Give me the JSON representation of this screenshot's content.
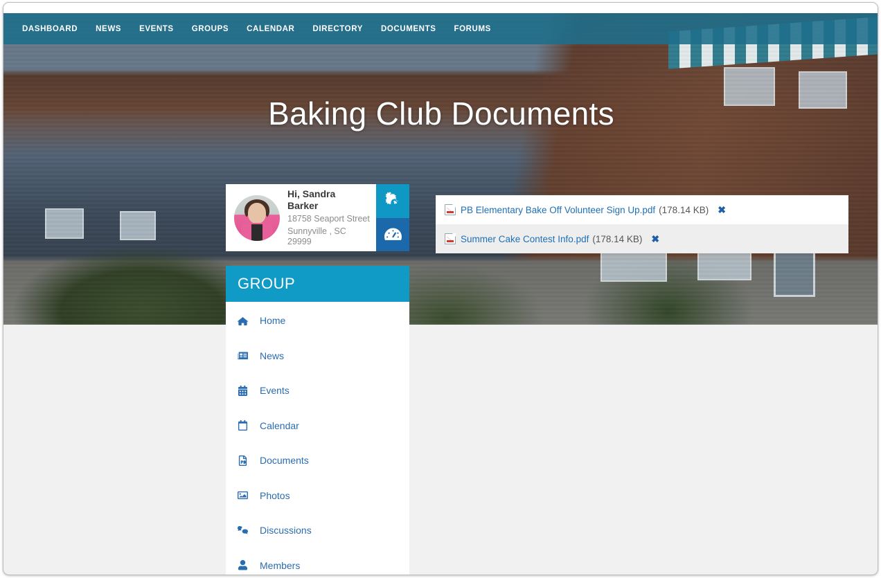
{
  "topnav": {
    "items": [
      {
        "label": "DASHBOARD",
        "name": "nav-dashboard"
      },
      {
        "label": "NEWS",
        "name": "nav-news"
      },
      {
        "label": "EVENTS",
        "name": "nav-events"
      },
      {
        "label": "GROUPS",
        "name": "nav-groups"
      },
      {
        "label": "CALENDAR",
        "name": "nav-calendar"
      },
      {
        "label": "DIRECTORY",
        "name": "nav-directory"
      },
      {
        "label": "DOCUMENTS",
        "name": "nav-documents"
      },
      {
        "label": "FORUMS",
        "name": "nav-forums"
      }
    ]
  },
  "hero": {
    "title": "Baking Club Documents"
  },
  "profile": {
    "greeting": "Hi, Sandra Barker",
    "address_line1": "18758 Seaport Street",
    "address_line2": "Sunnyville , SC 29999",
    "avatar_alt": "user-avatar-photo",
    "settings_icon": "gears-icon",
    "dashboard_icon": "tachometer-icon"
  },
  "group": {
    "header": "GROUP",
    "items": [
      {
        "label": "Home",
        "icon": "home-icon"
      },
      {
        "label": "News",
        "icon": "newspaper-icon"
      },
      {
        "label": "Events",
        "icon": "calendar-check-icon"
      },
      {
        "label": "Calendar",
        "icon": "calendar-icon"
      },
      {
        "label": "Documents",
        "icon": "file-pdf-icon"
      },
      {
        "label": "Photos",
        "icon": "image-icon"
      },
      {
        "label": "Discussions",
        "icon": "comments-icon"
      },
      {
        "label": "Members",
        "icon": "user-icon"
      }
    ]
  },
  "documents": {
    "rows": [
      {
        "name": "PB Elementary Bake Off Volunteer Sign Up.pdf",
        "size": "(178.14 KB)",
        "delete": "✖",
        "icon": "pdf-file-icon"
      },
      {
        "name": "Summer Cake Contest Info.pdf",
        "size": "(178.14 KB)",
        "delete": "✖",
        "icon": "pdf-file-icon"
      }
    ]
  },
  "colors": {
    "nav_bar": "#1e6e8c",
    "cyan": "#109ac6",
    "blue": "#1b69ab",
    "link": "#1f6fb5",
    "page_bg": "#f1f1f1",
    "row_alt": "#eeeeee"
  }
}
